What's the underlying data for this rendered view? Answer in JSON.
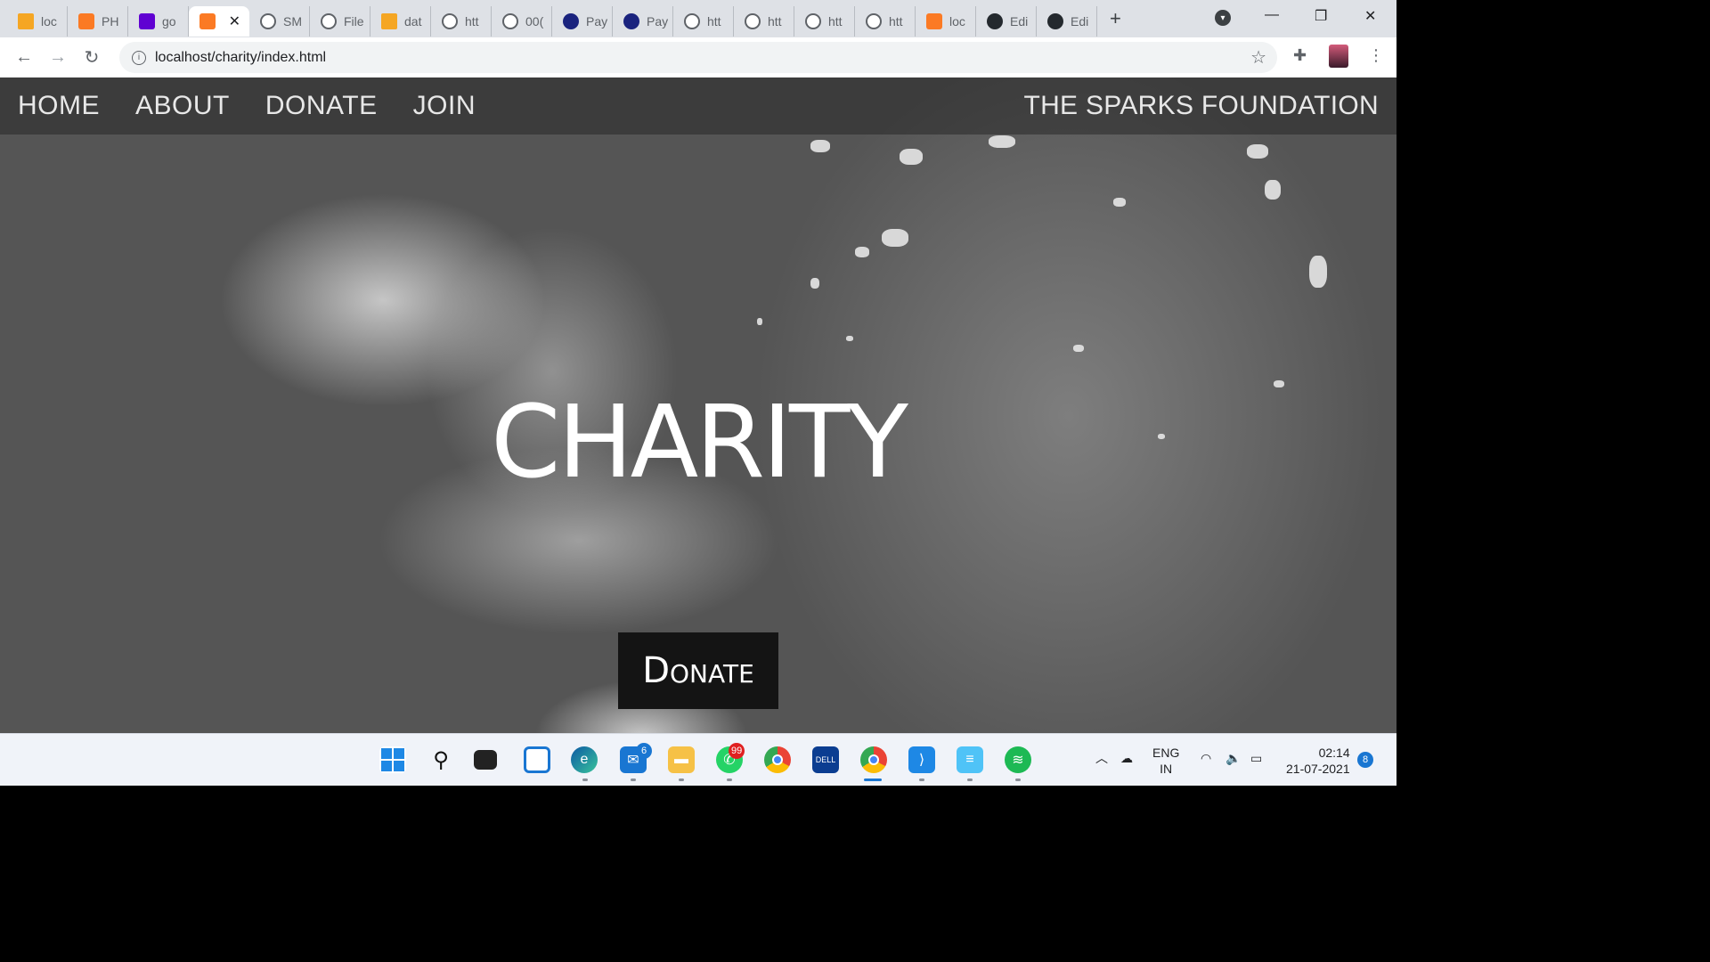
{
  "browser": {
    "tabs": [
      {
        "label": "loc",
        "icon": "phpmyadmin-icon",
        "kind": "pma"
      },
      {
        "label": "PH",
        "icon": "xampp-icon",
        "kind": "xampp"
      },
      {
        "label": "go",
        "icon": "yahoo-icon",
        "kind": "yahoo"
      },
      {
        "label": "",
        "icon": "xampp-icon",
        "kind": "xampp",
        "active": true
      },
      {
        "label": "SM",
        "icon": "globe-icon",
        "kind": "globe"
      },
      {
        "label": "File",
        "icon": "globe-icon",
        "kind": "globe"
      },
      {
        "label": "dat",
        "icon": "phpmyadmin-icon",
        "kind": "pma"
      },
      {
        "label": "htt",
        "icon": "globe-icon",
        "kind": "globe"
      },
      {
        "label": "00(",
        "icon": "globe-icon",
        "kind": "globe"
      },
      {
        "label": "Pay",
        "icon": "payment-icon",
        "kind": "pay"
      },
      {
        "label": "Pay",
        "icon": "payment-icon",
        "kind": "pay"
      },
      {
        "label": "htt",
        "icon": "globe-icon",
        "kind": "globe"
      },
      {
        "label": "htt",
        "icon": "globe-icon",
        "kind": "globe"
      },
      {
        "label": "htt",
        "icon": "globe-icon",
        "kind": "globe"
      },
      {
        "label": "htt",
        "icon": "globe-icon",
        "kind": "globe"
      },
      {
        "label": "loc",
        "icon": "xampp-icon",
        "kind": "xampp"
      },
      {
        "label": "Edi",
        "icon": "github-icon",
        "kind": "git"
      },
      {
        "label": "Edi",
        "icon": "github-icon",
        "kind": "git"
      }
    ],
    "address": "localhost/charity/index.html"
  },
  "site": {
    "nav": [
      "HOME",
      "ABOUT",
      "DONATE",
      "JOIN"
    ],
    "brand": "THE SPARKS FOUNDATION",
    "hero_title": "CHARITY",
    "donate_label": "Donate"
  },
  "taskbar": {
    "mail_badge": "6",
    "whatsapp_badge": "99",
    "lang_top": "ENG",
    "lang_bottom": "IN",
    "time": "02:14",
    "date": "21-07-2021",
    "notif_count": "8"
  }
}
